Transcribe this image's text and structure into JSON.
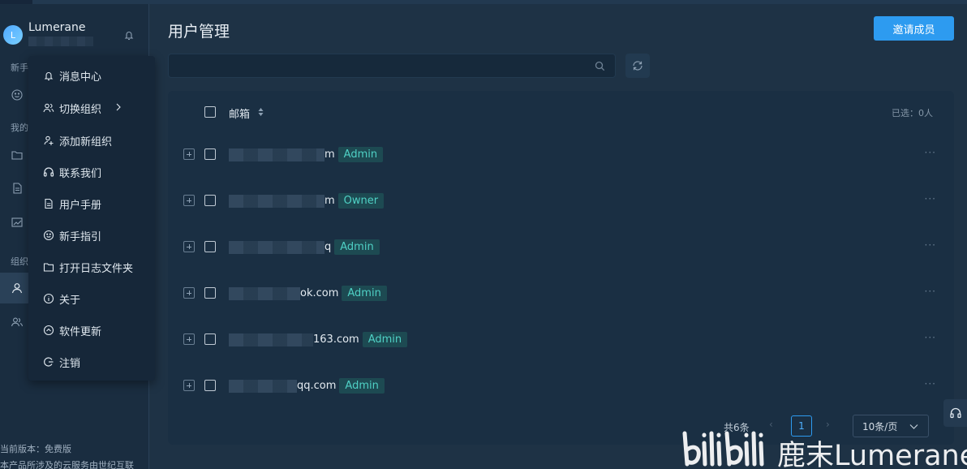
{
  "user": {
    "name": "Lumerane",
    "avatar_letter": "L"
  },
  "sidebar": {
    "labels": [
      "新手",
      "我的",
      "组织"
    ],
    "footer_version": "当前版本：免费版",
    "footer_note": "本产品所涉及的云服务由世纪互联"
  },
  "menu": {
    "items": [
      {
        "label": "消息中心",
        "icon": "bell-icon"
      },
      {
        "label": "切换组织",
        "icon": "users-icon",
        "has_submenu": true
      },
      {
        "label": "添加新组织",
        "icon": "user-add-icon"
      },
      {
        "label": "联系我们",
        "icon": "headset-icon"
      },
      {
        "label": "用户手册",
        "icon": "document-icon"
      },
      {
        "label": "新手指引",
        "icon": "smile-icon"
      },
      {
        "label": "打开日志文件夹",
        "icon": "folder-icon"
      },
      {
        "label": "关于",
        "icon": "info-icon"
      },
      {
        "label": "软件更新",
        "icon": "update-icon"
      },
      {
        "label": "注销",
        "icon": "logout-icon"
      }
    ]
  },
  "header": {
    "title": "用户管理",
    "invite_label": "邀请成员"
  },
  "search": {
    "placeholder": ""
  },
  "table": {
    "column_email": "邮箱",
    "selected_text": "已选：0人",
    "rows": [
      {
        "email_visible": "m",
        "role": "Admin"
      },
      {
        "email_visible": "m",
        "role": "Owner"
      },
      {
        "email_visible": "q",
        "role": "Admin"
      },
      {
        "email_visible": "ok.com",
        "role": "Admin"
      },
      {
        "email_visible": "163.com",
        "role": "Admin"
      },
      {
        "email_visible": "qq.com",
        "role": "Admin"
      }
    ],
    "row_actions": "···"
  },
  "pagination": {
    "total": "共6条",
    "current_page": "1",
    "page_size": "10条/页"
  },
  "watermark": {
    "text": "鹿末Lumerane"
  },
  "colors": {
    "accent": "#2d9bf0",
    "role_tag": "#4fd1c5",
    "background": "#1e3245"
  }
}
